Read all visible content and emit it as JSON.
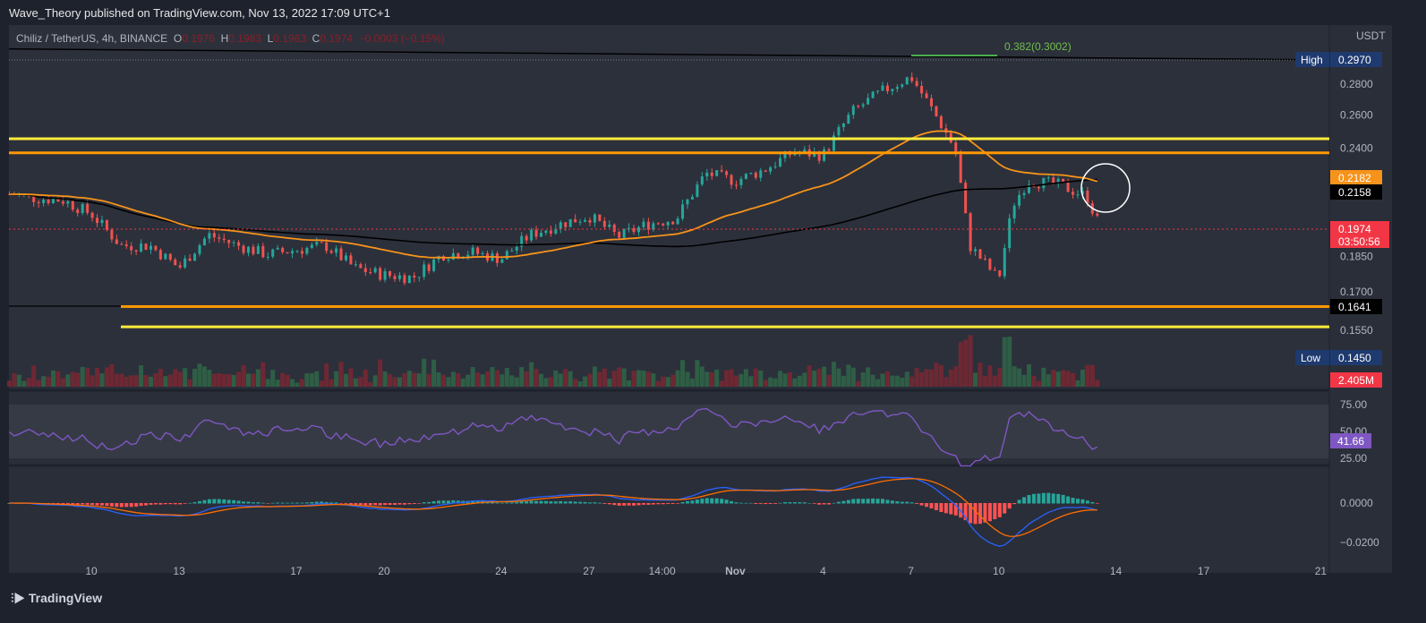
{
  "header": "Wave_Theory published on TradingView.com, Nov 13, 2022 17:09 UTC+1",
  "legend": {
    "symbol": "Chiliz / TetherUS, 4h, BINANCE",
    "o_label": "O",
    "o": "0.1976",
    "h_label": "H",
    "h": "0.1983",
    "l_label": "L",
    "l": "0.1963",
    "c_label": "C",
    "c": "0.1974",
    "change": "−0.0003 (−0.15%)"
  },
  "footer": "TradingView",
  "colors": {
    "up": "#26a69a",
    "down": "#ef5350",
    "ema": "#f7931a",
    "ma": "#000000",
    "yellow": "#ffeb3b",
    "orange": "#ff9800",
    "rsi": "#7e57c2"
  },
  "chart_data": {
    "type": "candlestick",
    "currency": "USDT",
    "scale": "log",
    "price_ticks": [
      "0.2800",
      "0.2600",
      "0.2400",
      "0.1850",
      "0.1700",
      "0.1550"
    ],
    "price_tick_values": [
      0.28,
      0.26,
      0.24,
      0.185,
      0.17,
      0.155
    ],
    "x_ticks": [
      "10",
      "13",
      "17",
      "20",
      "24",
      "27",
      "14:00",
      "Nov",
      "4",
      "7",
      "10",
      "14",
      "17",
      "21"
    ],
    "x_tick_days": [
      0,
      3,
      7,
      10,
      14,
      17,
      19.5,
      22,
      25,
      28,
      31,
      35,
      38,
      42
    ],
    "closes_by_day": [
      [
        -2.8,
        0.215
      ],
      [
        -2,
        0.213
      ],
      [
        -1,
        0.212
      ],
      [
        0,
        0.205
      ],
      [
        1,
        0.19
      ],
      [
        2,
        0.19
      ],
      [
        3,
        0.18
      ],
      [
        4,
        0.195
      ],
      [
        5,
        0.19
      ],
      [
        6,
        0.186
      ],
      [
        7,
        0.188
      ],
      [
        8,
        0.19
      ],
      [
        9,
        0.18
      ],
      [
        10,
        0.177
      ],
      [
        11,
        0.176
      ],
      [
        12,
        0.186
      ],
      [
        13,
        0.187
      ],
      [
        14,
        0.184
      ],
      [
        15,
        0.195
      ],
      [
        16,
        0.2
      ],
      [
        17,
        0.204
      ],
      [
        18,
        0.194
      ],
      [
        19,
        0.2
      ],
      [
        20,
        0.203
      ],
      [
        21,
        0.226
      ],
      [
        22,
        0.222
      ],
      [
        23,
        0.228
      ],
      [
        24,
        0.238
      ],
      [
        25,
        0.236
      ],
      [
        26,
        0.262
      ],
      [
        27,
        0.275
      ],
      [
        28,
        0.285
      ],
      [
        29,
        0.255
      ],
      [
        29.5,
        0.24
      ],
      [
        30,
        0.19
      ],
      [
        31,
        0.175
      ],
      [
        31.5,
        0.21
      ],
      [
        32,
        0.222
      ],
      [
        33,
        0.22
      ],
      [
        34,
        0.214
      ],
      [
        34.5,
        0.1974
      ]
    ],
    "levels": [
      {
        "price": 0.2456,
        "color": "#ffeb3b"
      },
      {
        "price": 0.2374,
        "color": "#ff9800"
      },
      {
        "price": 0.1641,
        "color": "#ff9800"
      },
      {
        "price": 0.1563,
        "color": "#ffeb3b"
      }
    ],
    "fib_label": "0.382(0.3002)",
    "labels": {
      "high_label": "High",
      "high": "0.2970",
      "low_label": "Low",
      "low": "0.1450",
      "ema": "0.2182",
      "ma": "0.2158",
      "last": "0.1974",
      "countdown": "03:50:56",
      "level": "0.1641",
      "volume": "2.405M",
      "rsi": "41.66"
    },
    "rsi_ticks": [
      "75.00",
      "50.00",
      "25.00"
    ],
    "macd_ticks": [
      "0.0000",
      "−0.0200"
    ]
  }
}
